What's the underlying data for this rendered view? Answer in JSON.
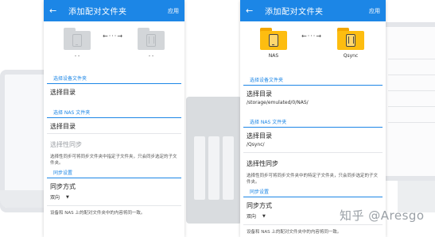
{
  "left_screen": {
    "title": "添加配对文件夹",
    "apply_label": "应用",
    "device_label": "- -",
    "nas_label": "- -",
    "link_arrow": "←···→",
    "device_section": "选择设备文件夹",
    "device_select": "选择目录",
    "nas_section": "选择 NAS 文件夹",
    "nas_select": "选择目录",
    "selective_sync": "选择性同步",
    "selective_hint": "选择性同步可将同步文件夹中指定子文件夹，只会同步选定的子文件夹。",
    "sync_section": "同步设置",
    "sync_mode_label": "同步方式",
    "sync_mode_value": "双向",
    "sync_mode_hint": "设备和 NAS 上的配对文件夹中的内容将同一致。"
  },
  "right_screen": {
    "title": "添加配对文件夹",
    "apply_label": "应用",
    "device_label": "NAS",
    "nas_label": "Qsync",
    "link_arrow": "←···→",
    "device_section": "选择设备文件夹",
    "device_select": "选择目录",
    "device_path": "/storage/emulated/0/NAS/",
    "nas_section": "选择 NAS 文件夹",
    "nas_select": "选择目录",
    "nas_path": "/Qsync/",
    "selective_sync": "选择性同步",
    "selective_hint": "选择性同步可将同步文件夹中的特定子文件夹，只会同步选定的子文件夹。",
    "sync_section": "同步设置",
    "sync_mode_label": "同步方式",
    "sync_mode_value": "双向",
    "sync_mode_hint": "设备和 NAS 上的配对文件夹中的内容将同一致。"
  },
  "watermark": "知乎 @Aresgo",
  "icons": {
    "back": "back-arrow-icon",
    "phone_folder": "phone-folder-icon",
    "nas_folder": "nas-folder-icon",
    "caret": "caret-down-icon"
  },
  "colors": {
    "app_bar": "#1c86e6",
    "folder_active": "#fdbd10",
    "folder_inactive": "#d3d6d9"
  }
}
